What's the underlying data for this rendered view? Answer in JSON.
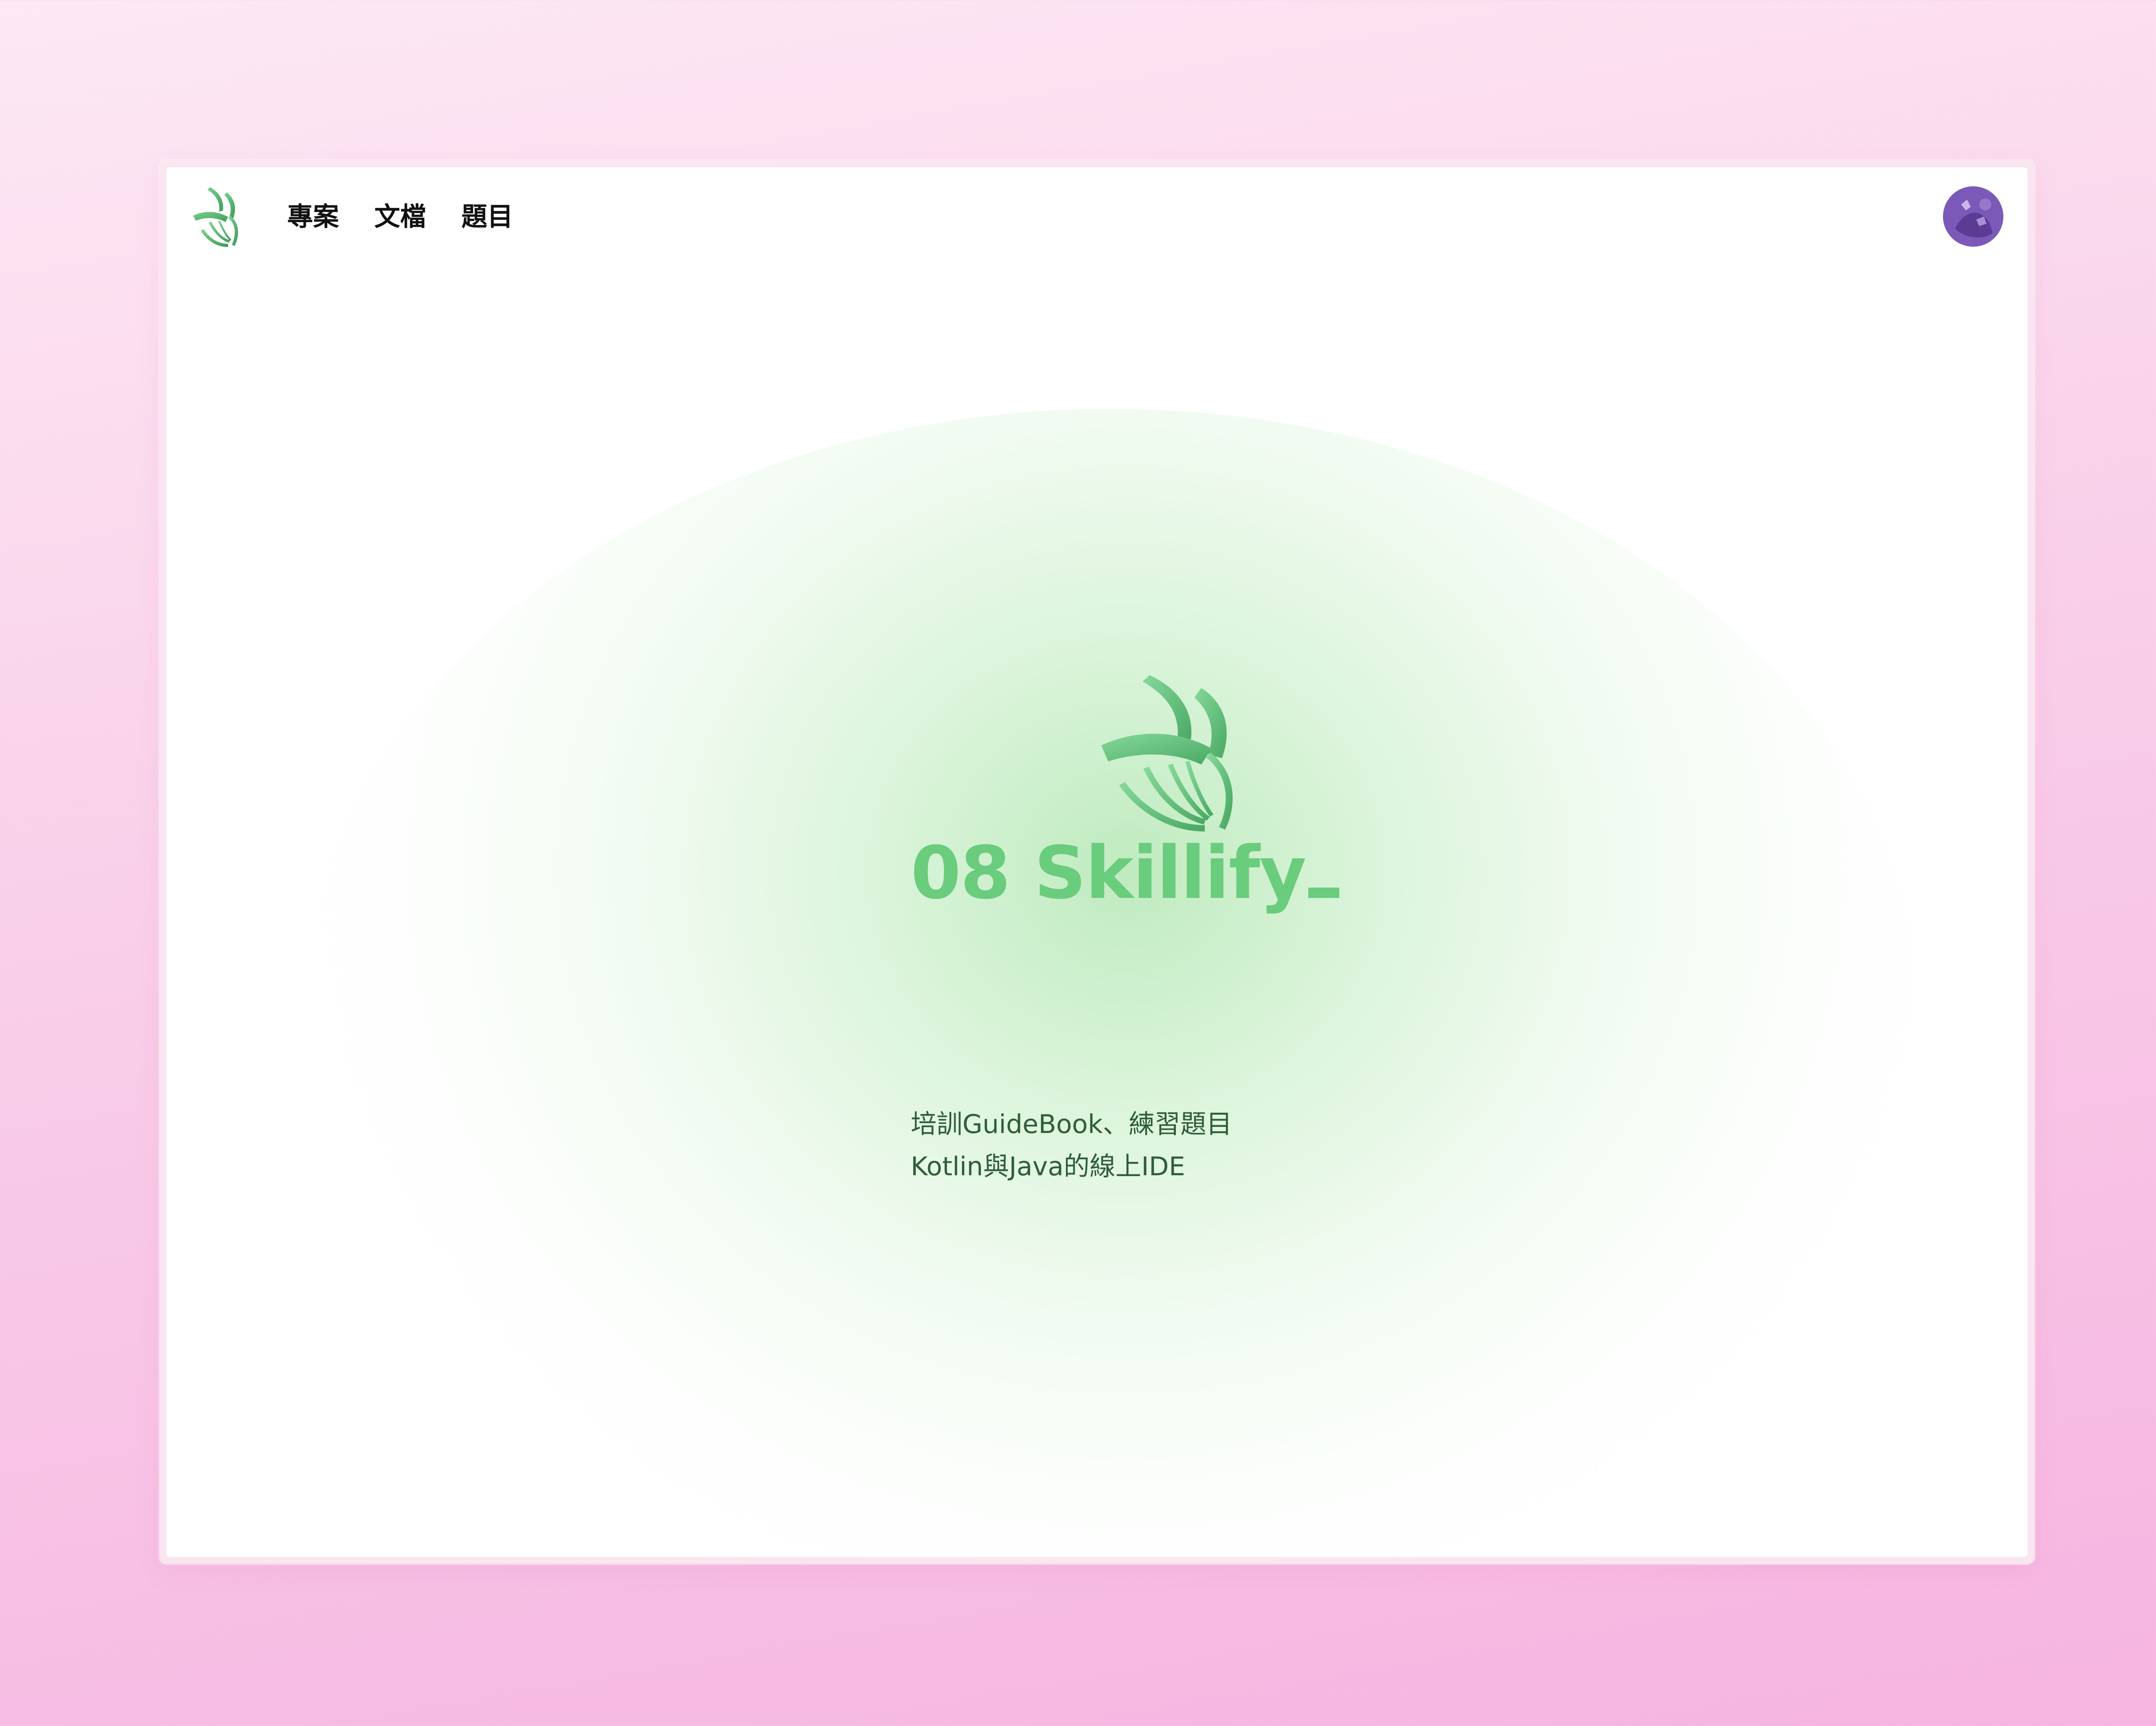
{
  "nav": {
    "items": [
      {
        "label": "專案"
      },
      {
        "label": "文檔"
      },
      {
        "label": "題目"
      }
    ],
    "logo_icon": "skillify-logo-icon",
    "avatar_icon": "user-avatar"
  },
  "hero": {
    "title": "08 Skillify",
    "desc_line1": "培訓GuideBook、練習題目",
    "desc_line2": "Kotlin與Java的線上IDE"
  },
  "colors": {
    "brand_green": "#6acc7d",
    "logo_dark_green": "#4fae6a",
    "text_dark_green": "#2f5e3a",
    "background_pink": "#f6b4e1"
  }
}
